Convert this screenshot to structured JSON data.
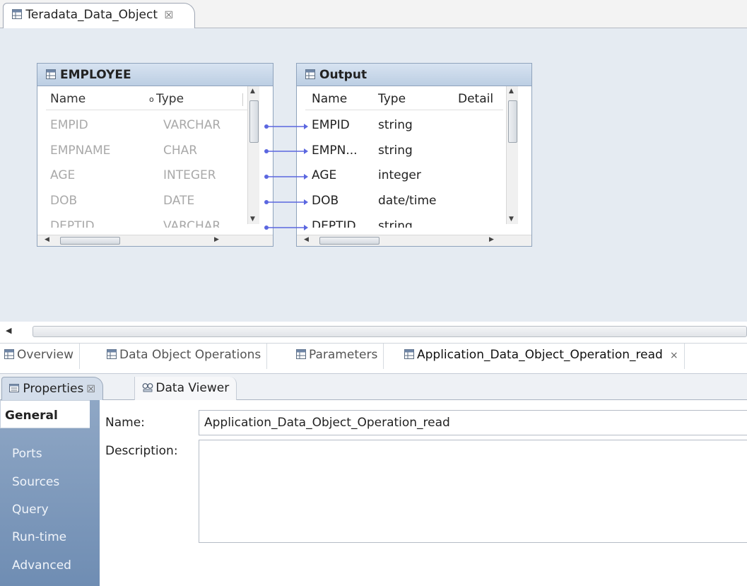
{
  "editor": {
    "tab_title": "Teradata_Data_Object",
    "tab_close": "☒"
  },
  "employee_table": {
    "title": "EMPLOYEE",
    "columns": [
      "Name",
      "Type"
    ],
    "rows": [
      {
        "name": "EMPID",
        "type": "VARCHAR"
      },
      {
        "name": "EMPNAME",
        "type": "CHAR"
      },
      {
        "name": "AGE",
        "type": "INTEGER"
      },
      {
        "name": "DOB",
        "type": "DATE"
      },
      {
        "name": "DEPTID",
        "type": "VARCHAR"
      }
    ]
  },
  "output_table": {
    "title": "Output",
    "columns": [
      "Name",
      "Type",
      "Detail"
    ],
    "rows": [
      {
        "name": "EMPID",
        "type": "string"
      },
      {
        "name": "EMPN...",
        "type": "string"
      },
      {
        "name": "AGE",
        "type": "integer"
      },
      {
        "name": "DOB",
        "type": "date/time"
      },
      {
        "name": "DEPTID",
        "type": "string"
      }
    ]
  },
  "bottom_tabs": [
    {
      "label": "Overview"
    },
    {
      "label": "Data Object Operations"
    },
    {
      "label": "Parameters"
    },
    {
      "label": "Application_Data_Object_Operation_read",
      "close": "×"
    }
  ],
  "properties": {
    "tabs": [
      {
        "label": "Properties",
        "close": "☒"
      },
      {
        "label": "Data Viewer"
      }
    ],
    "sidebar": [
      "General",
      "Ports",
      "Sources",
      "Query",
      "Run-time",
      "Advanced"
    ],
    "name_label": "Name:",
    "name_value": "Application_Data_Object_Operation_read",
    "description_label": "Description:",
    "description_value": ""
  },
  "colors": {
    "canvas_bg": "#e5ebf2",
    "connector": "#5b67e0",
    "sidebar_bg": "#7f9abd"
  }
}
